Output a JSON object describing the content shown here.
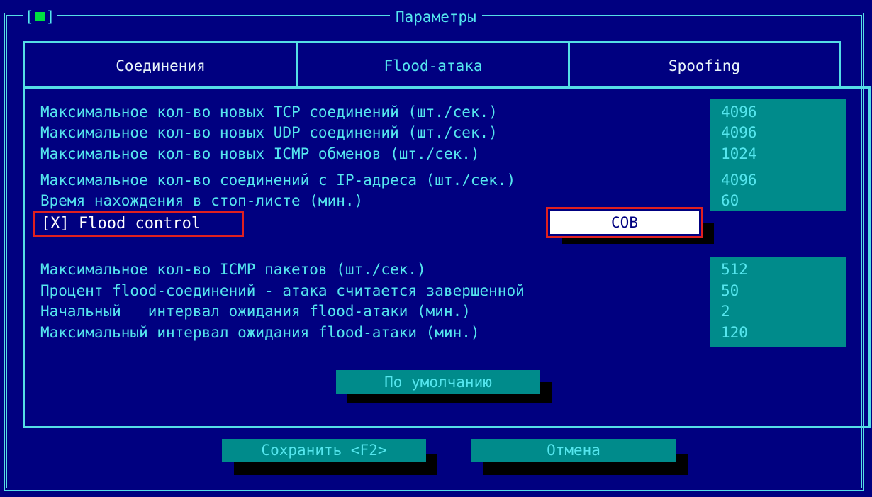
{
  "window": {
    "title": "Параметры",
    "close_left": "[",
    "close_right": "]"
  },
  "tabs": [
    {
      "label": "Соединения",
      "active": false
    },
    {
      "label": "Flood-атака",
      "active": true
    },
    {
      "label": "Spoofing",
      "active": false
    }
  ],
  "params_group1": [
    {
      "label": "Максимальное кол-во новых TCP соединений (шт./сек.)",
      "value": "4096"
    },
    {
      "label": "Максимальное кол-во новых UDP соединений (шт./сек.)",
      "value": "4096"
    },
    {
      "label": "Максимальное кол-во новых ICMP обменов (шт./сек.)",
      "value": "1024"
    },
    {
      "label": "Максимальное кол-во соединений с IP-адреса (шт./сек.)",
      "value": "4096"
    },
    {
      "label": "Время нахождения в стоп-листе (мин.)",
      "value": "60"
    }
  ],
  "flood_control": {
    "label": "[X] Flood control",
    "checked": true
  },
  "sov_field": {
    "value": "СОВ"
  },
  "params_group2": [
    {
      "label": "Максимальное кол-во ICMP пакетов (шт./сек.)",
      "value": "512"
    },
    {
      "label": "Процент flood-соединений - атака считается завершенной",
      "value": "50"
    },
    {
      "label": "Начальный   интервал ожидания flood-атаки (мин.)",
      "value": "2"
    },
    {
      "label": "Максимальный интервал ожидания flood-атаки (мин.)",
      "value": "120"
    }
  ],
  "buttons": {
    "default": "По умолчанию",
    "save": "Сохранить <F2>",
    "cancel": "Отмена"
  },
  "colors": {
    "background": "#000080",
    "frame": "#55dde6",
    "text": "#55e6ee",
    "field": "#008b8b",
    "highlight_border": "#e02020"
  }
}
